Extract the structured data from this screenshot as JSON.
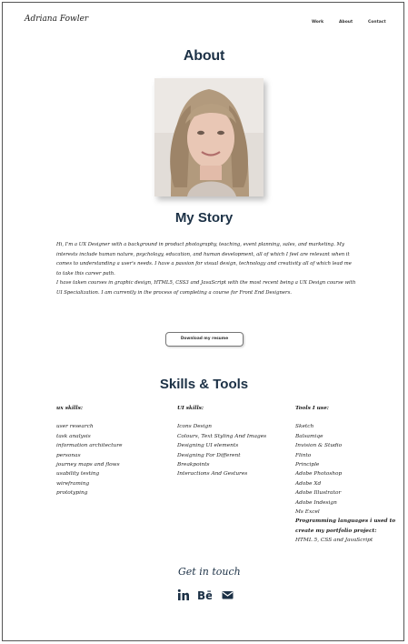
{
  "header": {
    "brand": "Adriana Fowler",
    "nav": [
      "Work",
      "About",
      "Contact"
    ]
  },
  "about": {
    "title": "About",
    "photo_alt": "portrait photo"
  },
  "story": {
    "title": "My Story",
    "paragraphs": [
      "Hi, I'm a UX Designer with a background in product photography, teaching, event planning, sales, and marketing. My interests include human nature, psychology, education, and human development, all of which I feel are relevant when it comes to understanding a user's needs. I have a passion for visual design, technology and creativity all of which lead me to take this career path.",
      "I have taken courses in graphic design, HTML5, CSS3 and JavaScript with the most recent being a UX Design course with UI Specialization. I am currently in the process of completing a course for Front End Designers."
    ],
    "download_label": "Download my resume"
  },
  "skills": {
    "title": "Skills & Tools",
    "ux": {
      "heading": "ux skills:",
      "items": [
        "user research",
        "task analysis",
        "information architecture",
        "personas",
        "journey maps and flows",
        "usability testing",
        "wireframing",
        "prototyping"
      ]
    },
    "ui": {
      "heading": "UI skills:",
      "items": [
        "Icons Design",
        "Colours, Text Styling And Images",
        "Designing UI elements",
        "Designing For Different",
        "Breakpoints",
        "Interactions And Gestures"
      ]
    },
    "tools": {
      "heading": "Tools I use:",
      "items": [
        "Sketch",
        "Balsamiqe",
        "Invision & Studio",
        "Flinto",
        "Principle",
        "Adobe Photoshop",
        "Adobe Xd",
        "Adobe Illustrator",
        "Adobe Indesign",
        "Ms Excel"
      ],
      "languages_heading_1": "Programming languages i used to",
      "languages_heading_2": "create my portfolio project:",
      "languages": "HTML 5, CSS and JavaScript"
    }
  },
  "contact": {
    "title": "Get in touch",
    "icons": [
      "linkedin-icon",
      "behance-icon",
      "mail-icon"
    ]
  }
}
